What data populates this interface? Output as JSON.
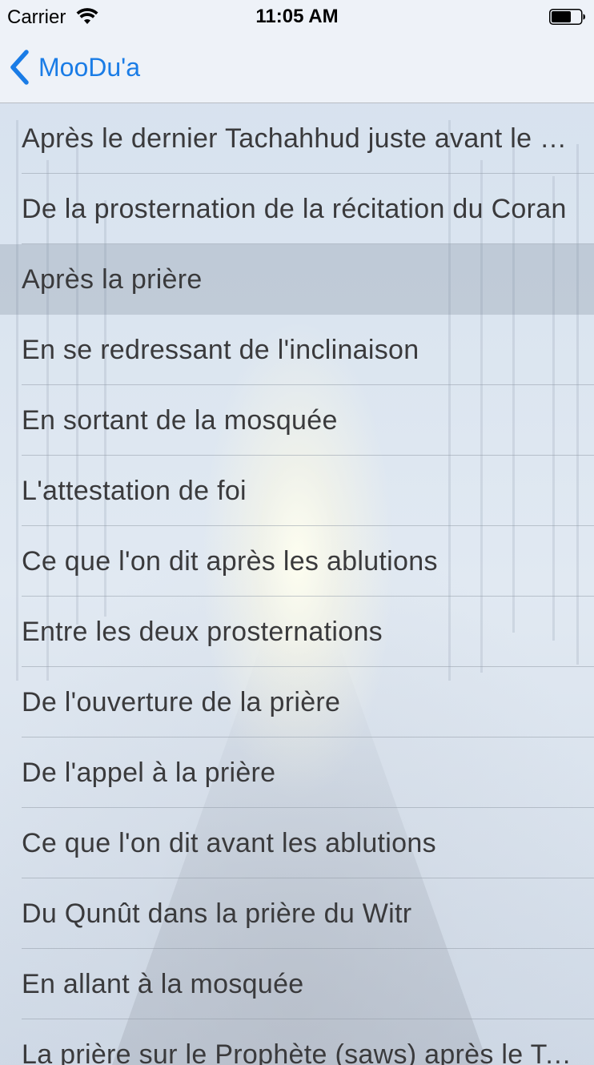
{
  "status_bar": {
    "carrier": "Carrier",
    "time": "11:05 AM",
    "wifi_icon": "wifi-icon",
    "battery_icon": "battery-icon"
  },
  "nav_bar": {
    "back_label": "MooDu'a",
    "back_icon": "chevron-left-icon",
    "accent_color": "#1a7ce6"
  },
  "list": {
    "selected_index": 2,
    "items": [
      "Après le dernier Tachahhud juste avant le Salam",
      "De la prosternation de la récitation du Coran",
      "Après la prière",
      "En se redressant de l'inclinaison",
      "En sortant de la mosquée",
      "L'attestation de foi",
      "Ce que l'on dit après les ablutions",
      "Entre les deux prosternations",
      "De l'ouverture de la prière",
      "De l'appel à la prière",
      "Ce que l'on dit avant les ablutions",
      "Du Qunût dans la prière du Witr",
      "En allant à la mosquée",
      "La prière sur le Prophète (saws) après le Tachahhud"
    ]
  }
}
